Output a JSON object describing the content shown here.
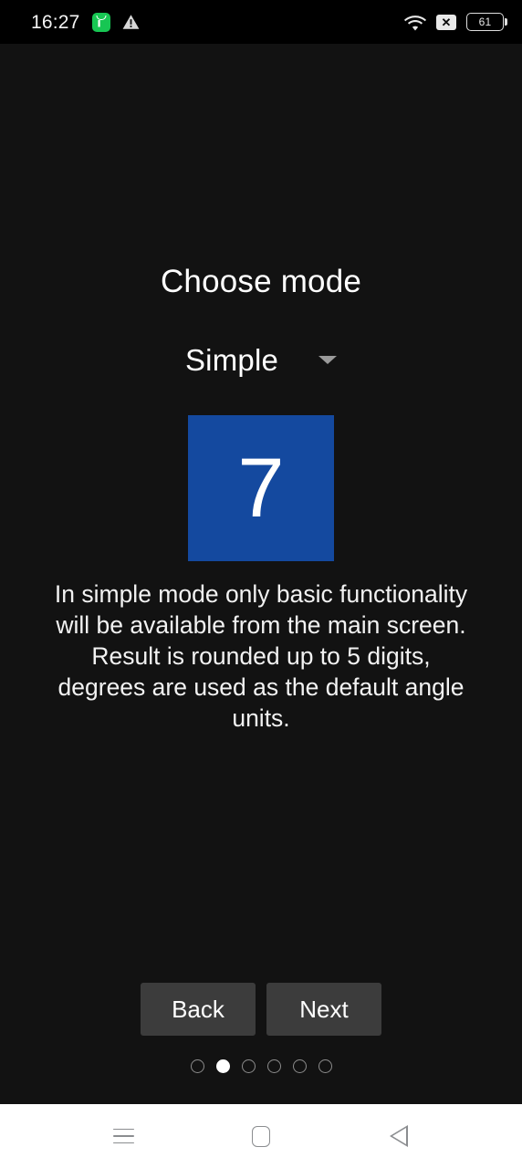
{
  "status_bar": {
    "time": "16:27",
    "battery_level": "61",
    "icons": {
      "app_green": "green-app-pause-icon",
      "warning": "warning-triangle-icon",
      "wifi": "wifi-icon",
      "mobile_data_off": "x-box-icon",
      "battery": "battery-icon"
    },
    "mobile_data_glyph": "✕"
  },
  "screen": {
    "title": "Choose mode",
    "mode": {
      "selected": "Simple",
      "caret": "chevron-down-icon"
    },
    "figure": {
      "number": "7",
      "color": "#14499F"
    },
    "description": "In simple mode only basic functionality will be available from the main screen. Result is rounded up to 5 digits, degrees are used as the default angle units."
  },
  "footer": {
    "back_label": "Back",
    "next_label": "Next",
    "dots": {
      "total": 6,
      "active_index": 1
    }
  },
  "android_nav": {
    "recents": "menu-icon",
    "home": "home-icon",
    "back": "back-icon"
  },
  "colors": {
    "background": "#121212",
    "status_bar": "#000000",
    "accent_blue": "#14499F",
    "button": "#3C3C3C",
    "nav_bar": "#FFFFFF"
  }
}
